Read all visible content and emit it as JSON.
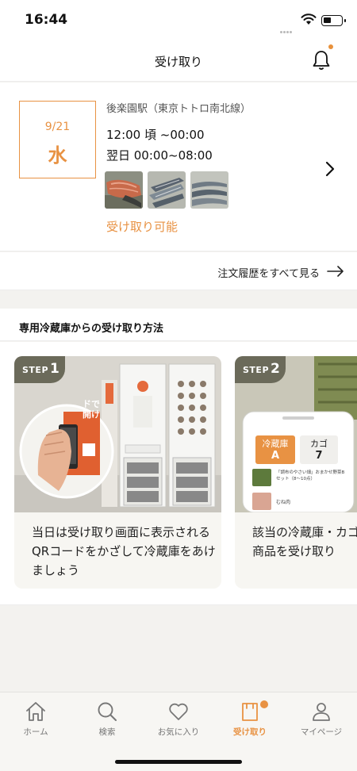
{
  "status_bar": {
    "time": "16:44"
  },
  "header": {
    "title": "受け取り"
  },
  "order": {
    "month_day": "9/21",
    "weekday": "水",
    "station": "後楽園駅（東京トトロ南北線）",
    "slot_today": "12:00 頃 ~00:00",
    "slot_next": "翌日 00:00~08:00",
    "thumbnails": [
      "salmon-fillet",
      "mackerel-fish",
      "sanma-fish"
    ],
    "pickup_status": "受け取り可能"
  },
  "history": {
    "label": "注文履歴をすべて見る"
  },
  "howto": {
    "title": "専用冷蔵庫からの受け取り方法",
    "steps": [
      {
        "badge_word": "STEP",
        "badge_num": "1",
        "text": "当日は受け取り画面に表示されるQRコードをかざして冷蔵庫をあけましょう",
        "sign_text": "ドで開け"
      },
      {
        "badge_word": "STEP",
        "badge_num": "2",
        "text": "該当の冷蔵庫・カゴから商品を受け取り",
        "fridge_label": "冷蔵庫",
        "fridge_value": "A",
        "basket_label": "カゴ",
        "basket_value": "7",
        "item1": "「調布のやさい畑」おまかせ野菜Bセット（8～10点）",
        "item2": "むね肉"
      }
    ]
  },
  "tabbar": {
    "items": [
      {
        "label": "ホーム",
        "icon": "home-icon",
        "active": false
      },
      {
        "label": "検索",
        "icon": "search-icon",
        "active": false
      },
      {
        "label": "お気に入り",
        "icon": "heart-icon",
        "active": false
      },
      {
        "label": "受け取り",
        "icon": "bag-icon",
        "active": true
      },
      {
        "label": "マイページ",
        "icon": "person-icon",
        "active": false
      }
    ]
  },
  "colors": {
    "accent": "#e89243",
    "step_badge": "#6b6a5a"
  }
}
